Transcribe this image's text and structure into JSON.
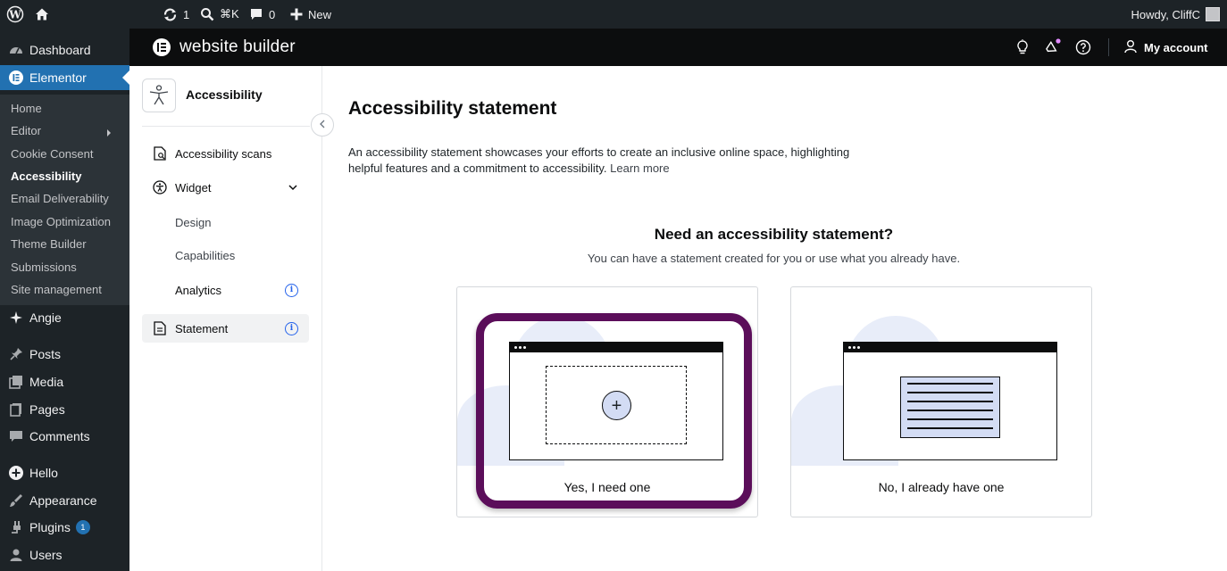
{
  "admin_bar": {
    "updates_count": "1",
    "search_shortcut": "⌘K",
    "comments_count": "0",
    "new_label": "New",
    "howdy": "Howdy, CliffC",
    "icons": [
      "wordpress-logo-icon",
      "home-icon",
      "refresh-icon",
      "search-icon",
      "comment-icon",
      "plus-icon"
    ]
  },
  "admin_menu": {
    "dashboard": "Dashboard",
    "elementor": "Elementor",
    "submenu": [
      "Home",
      "Editor",
      "Cookie Consent",
      "Accessibility",
      "Email Deliverability",
      "Image Optimization",
      "Theme Builder",
      "Submissions",
      "Site management"
    ],
    "angie": "Angie",
    "posts": "Posts",
    "media": "Media",
    "pages": "Pages",
    "comments": "Comments",
    "hello": "Hello",
    "appearance": "Appearance",
    "plugins": "Plugins",
    "plugins_badge": "1",
    "users": "Users"
  },
  "topbar": {
    "title": "website builder",
    "my_account": "My account",
    "icons": [
      "lightbulb-icon",
      "megaphone-icon",
      "help-icon",
      "user-icon"
    ],
    "notification_dot_color": "#e28bff"
  },
  "left_panel": {
    "title": "Accessibility",
    "items": {
      "scans": "Accessibility scans",
      "widget": "Widget",
      "design": "Design",
      "capabilities": "Capabilities",
      "analytics": "Analytics",
      "statement": "Statement"
    },
    "info_glyph": "i"
  },
  "main": {
    "title": "Accessibility statement",
    "description": "An accessibility statement showcases your efforts to create an inclusive online space, highlighting helpful features and a commitment to accessibility.",
    "learn_more": "Learn more",
    "question": "Need an accessibility statement?",
    "question_sub": "You can have a statement created for you or use what you already have.",
    "option_yes": "Yes, I need one",
    "option_no": "No, I already have one",
    "plus_glyph": "+",
    "highlight_color": "#5b0e5a"
  }
}
